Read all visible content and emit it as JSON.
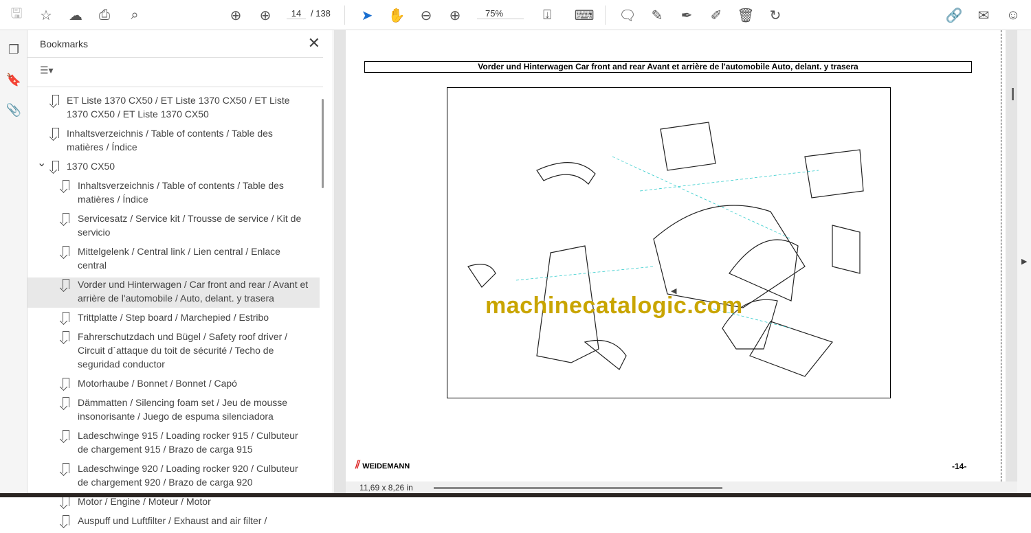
{
  "toolbar": {
    "page_current": "14",
    "page_total": "/ 138",
    "zoom": "75%",
    "icons": [
      "save-icon",
      "star-icon",
      "upload-cloud-icon",
      "print-icon",
      "search-zoom-icon",
      "page-up-icon",
      "page-down-icon",
      "select-cursor-icon",
      "hand-icon",
      "zoom-out-icon",
      "zoom-in-icon",
      "fit-page-icon",
      "scroll-mode-icon",
      "comment-icon",
      "highlight-icon",
      "sign-icon",
      "edit-file-icon",
      "delete-icon",
      "rotate-icon",
      "link-icon",
      "mail-icon",
      "add-user-icon"
    ]
  },
  "bookmarks": {
    "title": "Bookmarks",
    "items": [
      {
        "label": "ET Liste 1370 CX50 / ET Liste 1370 CX50 / ET Liste 1370 CX50 / ET Liste 1370 CX50",
        "level": 0
      },
      {
        "label": "Inhaltsverzeichnis / Table of contents / Table des matières / Índice",
        "level": 0
      },
      {
        "label": "1370 CX50",
        "level": 0,
        "expanded": true
      },
      {
        "label": "Inhaltsverzeichnis / Table of contents / Table des matières / Índice",
        "level": 1
      },
      {
        "label": "Servicesatz / Service kit / Trousse de service / Kit de servicio",
        "level": 1
      },
      {
        "label": "Mittelgelenk / Central link / Lien central / Enlace central",
        "level": 1
      },
      {
        "label": "Vorder und Hinterwagen / Car front and rear / Avant et arrière de l'automobile / Auto, delant. y trasera",
        "level": 1,
        "selected": true
      },
      {
        "label": "Trittplatte / Step board / Marchepied / Estribo",
        "level": 1
      },
      {
        "label": "Fahrerschutzdach und Bügel / Safety roof driver / Circuit d´attaque du toit de sécurité / Techo de seguridad conductor",
        "level": 1
      },
      {
        "label": "Motorhaube / Bonnet / Bonnet / Capó",
        "level": 1
      },
      {
        "label": "Dämmatten / Silencing foam set / Jeu de mousse insonorisante / Juego de espuma silenciadora",
        "level": 1
      },
      {
        "label": "Ladeschwinge 915 / Loading rocker 915 / Culbuteur de chargement 915 / Brazo de carga 915",
        "level": 1
      },
      {
        "label": "Ladeschwinge 920 / Loading rocker 920 / Culbuteur de chargement 920 / Brazo de carga 920",
        "level": 1
      },
      {
        "label": "Motor / Engine / Moteur / Motor",
        "level": 1
      },
      {
        "label": "Auspuff und Luftfilter / Exhaust and air filter /",
        "level": 1
      }
    ]
  },
  "document": {
    "header": "Vorder und Hinterwagen Car front and rear Avant et arrière de l'automobile Auto, delant. y trasera",
    "watermark": "machinecatalogic.com",
    "logo": "WEIDEMANN",
    "page_label": "-14-",
    "page_size": "11,69 x 8,26 in"
  }
}
